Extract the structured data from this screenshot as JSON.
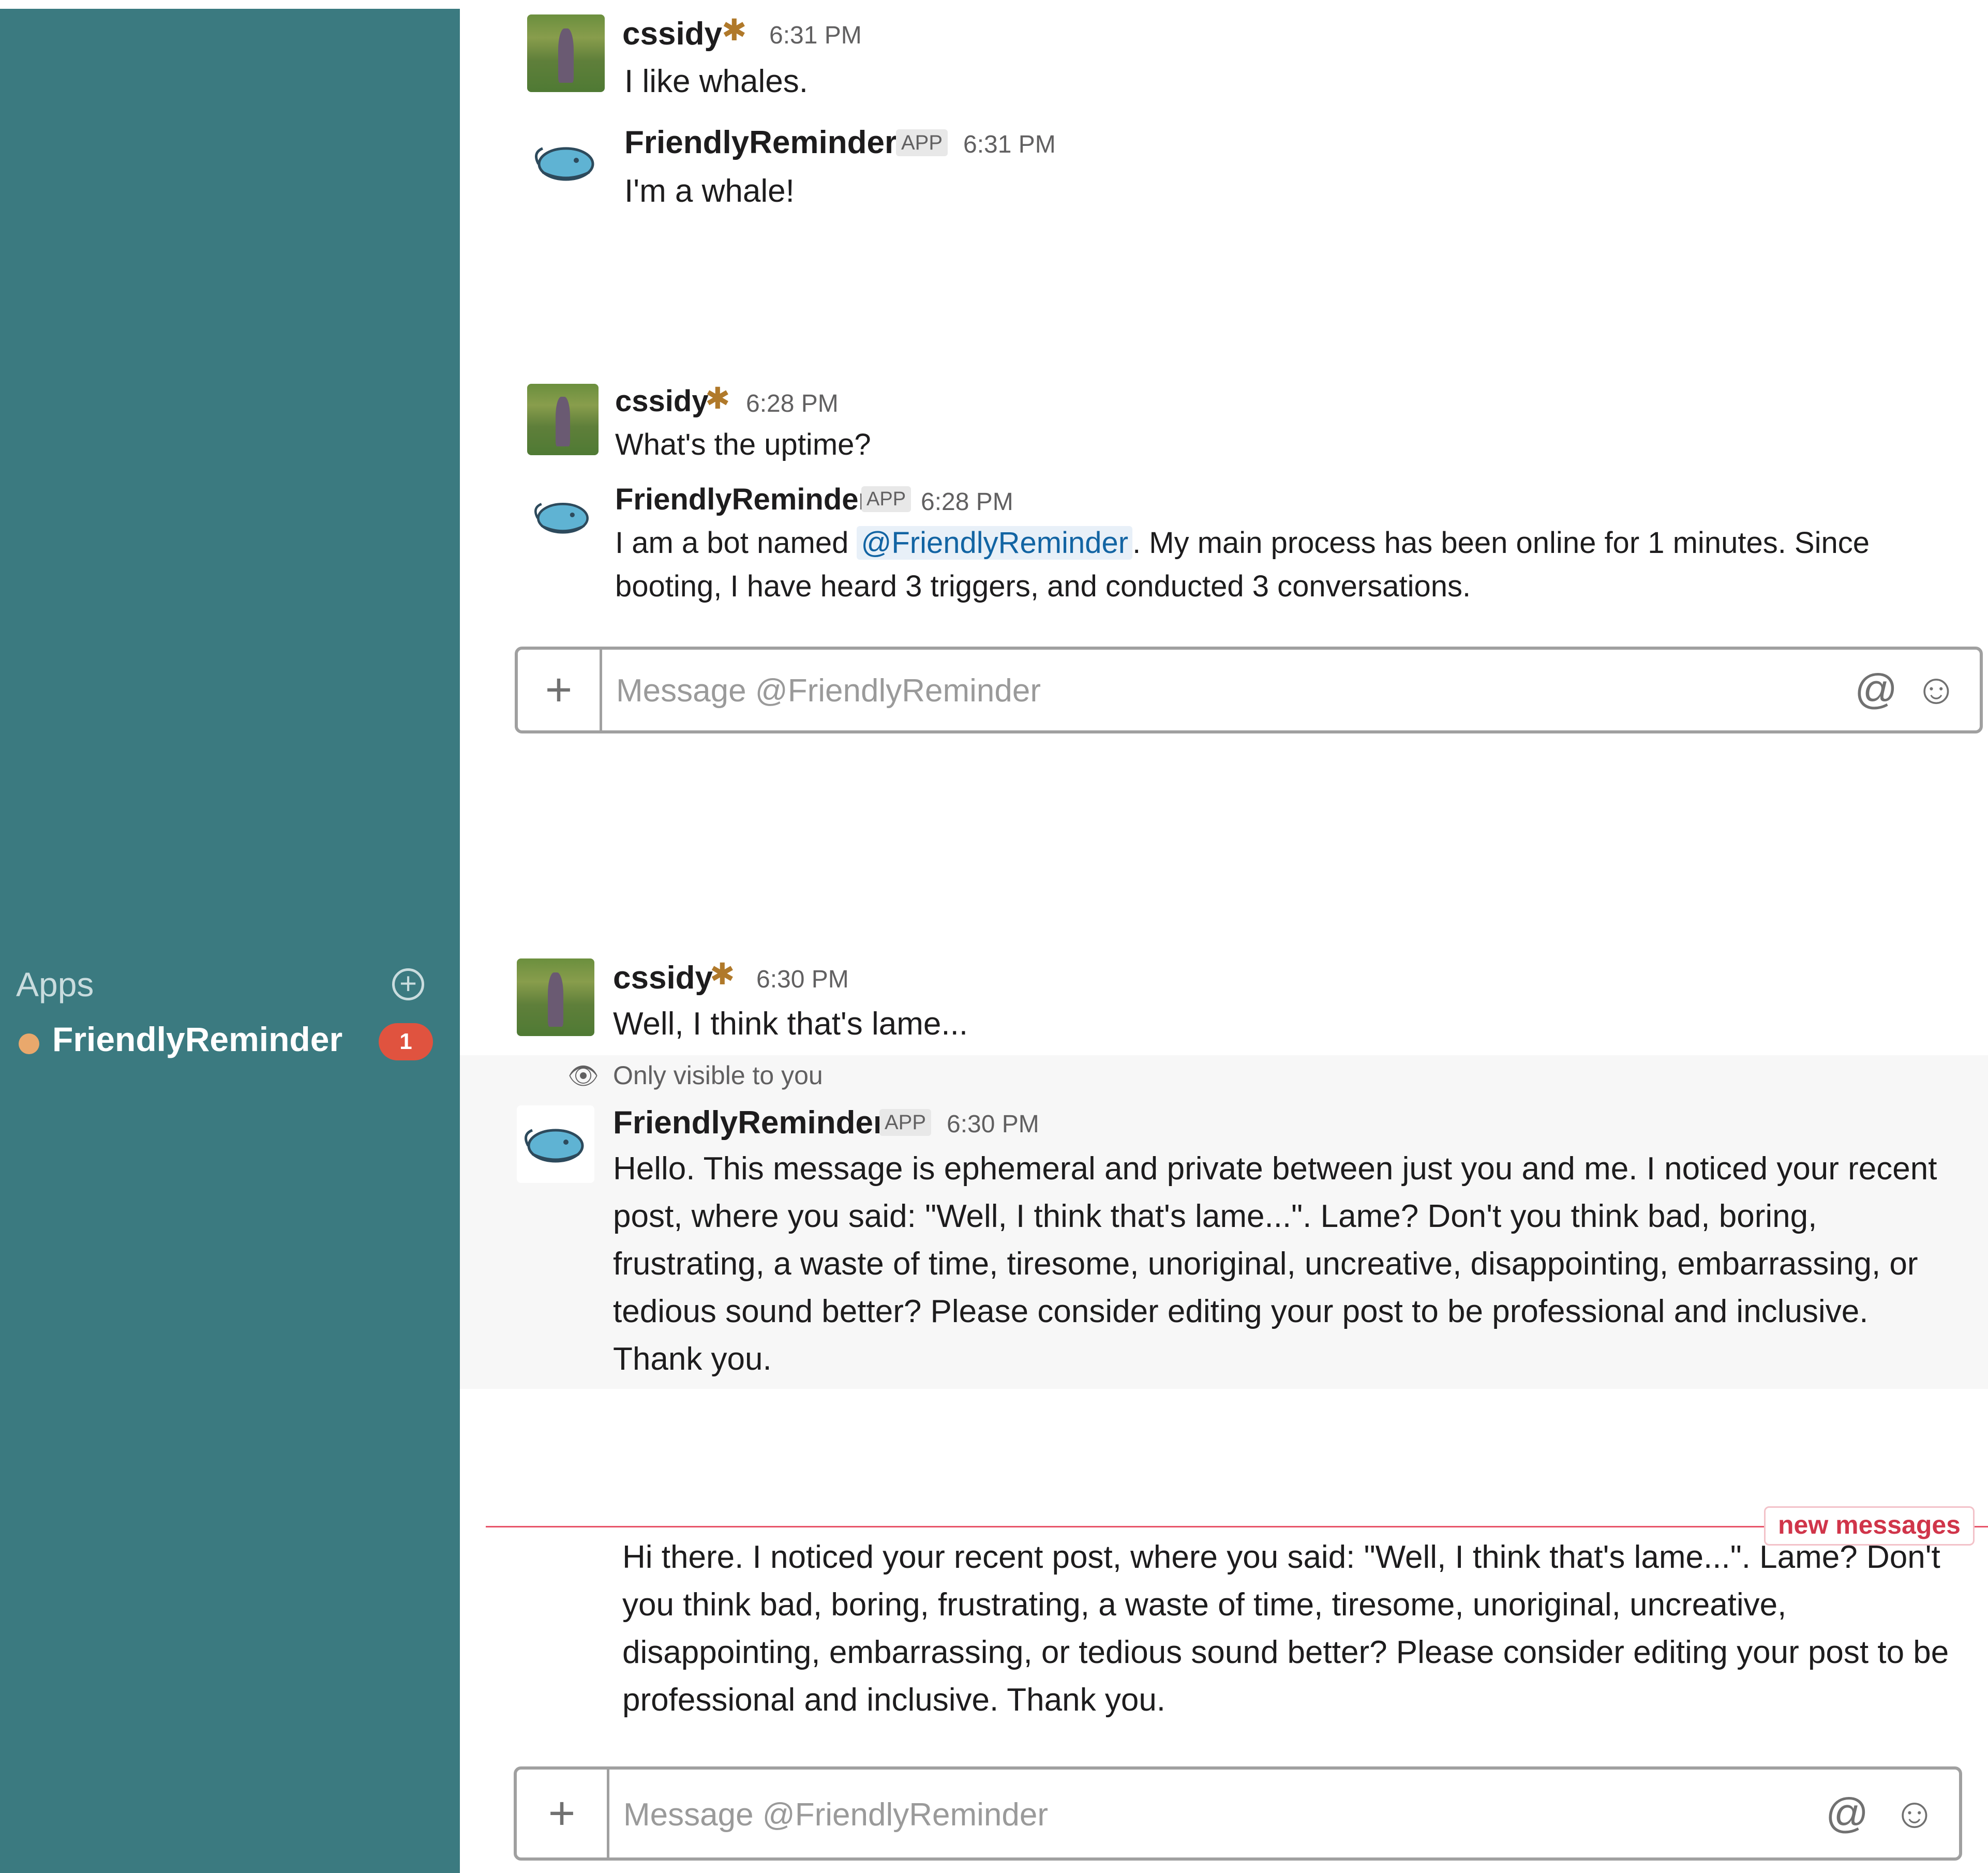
{
  "sidebar": {
    "section_label": "Apps",
    "add_icon": "plus-circle-icon",
    "dm": {
      "name": "FriendlyReminder",
      "status_color": "#e9a86c",
      "unread_count": "1"
    },
    "bg_color": "#3b7a80"
  },
  "block1": {
    "msg1": {
      "author": "cssidy",
      "emoji": "spider-emoji",
      "time": "6:31 PM",
      "text": "I like whales."
    },
    "msg2": {
      "author": "FriendlyReminder",
      "tag": "APP",
      "time": "6:31 PM",
      "text": "I'm a whale!"
    }
  },
  "block2": {
    "msg1": {
      "author": "cssidy",
      "time": "6:28 PM",
      "text": "What's the uptime?"
    },
    "msg2": {
      "author": "FriendlyReminder",
      "tag": "APP",
      "time": "6:28 PM",
      "text_before": "I am a bot named ",
      "mention": "@FriendlyReminder",
      "text_after": ". My main process has been online for 1 minutes. Since booting, I have heard 3 triggers, and conducted 3 conversations."
    },
    "composer": {
      "placeholder": "Message @FriendlyReminder"
    }
  },
  "block3": {
    "msg1": {
      "author": "cssidy",
      "time": "6:30 PM",
      "text": "Well, I think that's lame..."
    },
    "ephemeral_note": "Only visible to you",
    "msg2": {
      "author": "FriendlyReminder",
      "tag": "APP",
      "time": "6:30 PM",
      "text": "Hello. This message is ephemeral and private between just you and me. I noticed your recent post, where you said: \"Well, I think that's lame...\". Lame? Don't you think bad, boring, frustrating, a waste of time, tiresome, unoriginal, uncreative, disappointing, embarrassing, or tedious sound better? Please consider editing your post to be professional and inclusive. Thank you."
    }
  },
  "block4": {
    "divider_label": "new messages",
    "text": "Hi there. I noticed your recent post, where you said: \"Well, I think that's lame...\". Lame? Don't you think bad, boring, frustrating, a waste of time, tiresome, unoriginal, uncreative, disappointing, embarrassing, or tedious sound better? Please consider editing your post to be professional and inclusive. Thank you.",
    "composer": {
      "placeholder": "Message @FriendlyReminder"
    }
  }
}
